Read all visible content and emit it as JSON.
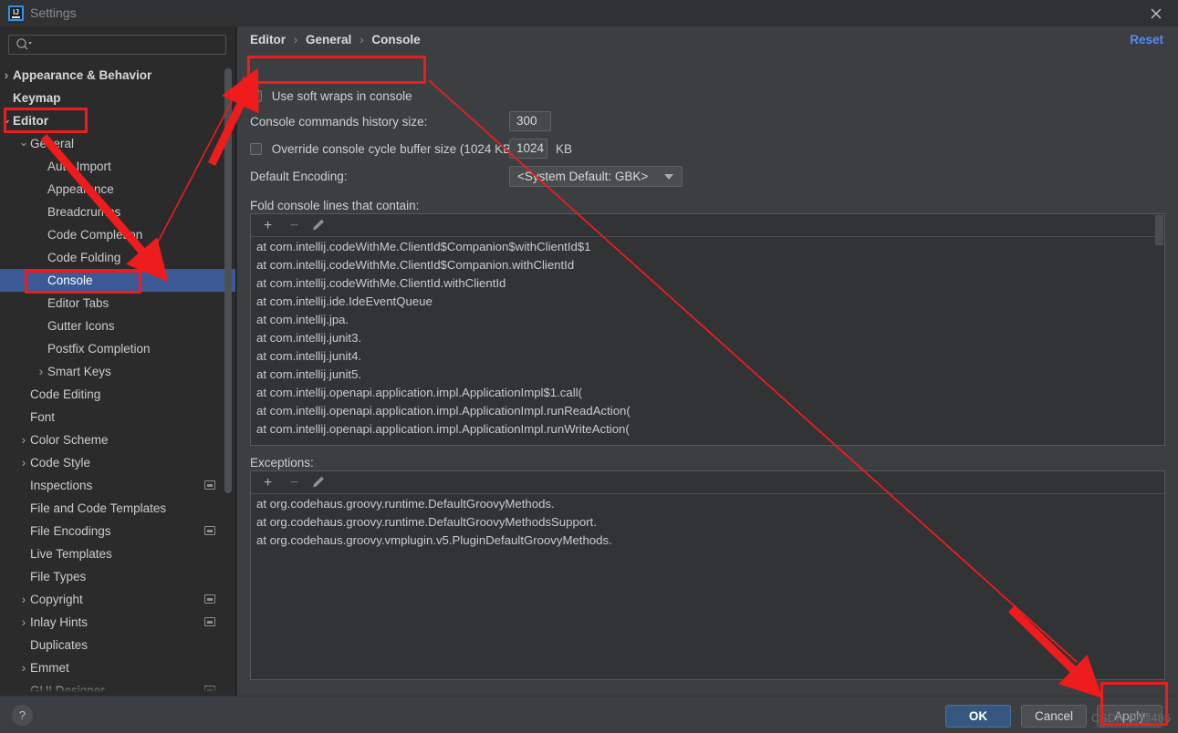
{
  "window": {
    "title": "Settings",
    "app_icon": "intellij-idea-icon",
    "close_icon": "close-icon"
  },
  "sidebar": {
    "search": {
      "placeholder": "",
      "value": "",
      "icon": "search-icon"
    },
    "items": [
      {
        "label": "Appearance & Behavior",
        "indent": 0,
        "arrow": "collapsed",
        "bold": true,
        "selected": false,
        "badge": false
      },
      {
        "label": "Keymap",
        "indent": 0,
        "arrow": "none",
        "bold": true,
        "selected": false,
        "badge": false
      },
      {
        "label": "Editor",
        "indent": 0,
        "arrow": "expanded",
        "bold": true,
        "selected": false,
        "badge": false
      },
      {
        "label": "General",
        "indent": 1,
        "arrow": "expanded",
        "bold": false,
        "selected": false,
        "badge": false
      },
      {
        "label": "Auto Import",
        "indent": 2,
        "arrow": "none",
        "bold": false,
        "selected": false,
        "badge": false
      },
      {
        "label": "Appearance",
        "indent": 2,
        "arrow": "none",
        "bold": false,
        "selected": false,
        "badge": false
      },
      {
        "label": "Breadcrumbs",
        "indent": 2,
        "arrow": "none",
        "bold": false,
        "selected": false,
        "badge": false
      },
      {
        "label": "Code Completion",
        "indent": 2,
        "arrow": "none",
        "bold": false,
        "selected": false,
        "badge": false
      },
      {
        "label": "Code Folding",
        "indent": 2,
        "arrow": "none",
        "bold": false,
        "selected": false,
        "badge": false
      },
      {
        "label": "Console",
        "indent": 2,
        "arrow": "none",
        "bold": false,
        "selected": true,
        "badge": false
      },
      {
        "label": "Editor Tabs",
        "indent": 2,
        "arrow": "none",
        "bold": false,
        "selected": false,
        "badge": false
      },
      {
        "label": "Gutter Icons",
        "indent": 2,
        "arrow": "none",
        "bold": false,
        "selected": false,
        "badge": false
      },
      {
        "label": "Postfix Completion",
        "indent": 2,
        "arrow": "none",
        "bold": false,
        "selected": false,
        "badge": false
      },
      {
        "label": "Smart Keys",
        "indent": 2,
        "arrow": "collapsed",
        "bold": false,
        "selected": false,
        "badge": false
      },
      {
        "label": "Code Editing",
        "indent": 1,
        "arrow": "none",
        "bold": false,
        "selected": false,
        "badge": false
      },
      {
        "label": "Font",
        "indent": 1,
        "arrow": "none",
        "bold": false,
        "selected": false,
        "badge": false
      },
      {
        "label": "Color Scheme",
        "indent": 1,
        "arrow": "collapsed",
        "bold": false,
        "selected": false,
        "badge": false
      },
      {
        "label": "Code Style",
        "indent": 1,
        "arrow": "collapsed",
        "bold": false,
        "selected": false,
        "badge": false
      },
      {
        "label": "Inspections",
        "indent": 1,
        "arrow": "none",
        "bold": false,
        "selected": false,
        "badge": true
      },
      {
        "label": "File and Code Templates",
        "indent": 1,
        "arrow": "none",
        "bold": false,
        "selected": false,
        "badge": false
      },
      {
        "label": "File Encodings",
        "indent": 1,
        "arrow": "none",
        "bold": false,
        "selected": false,
        "badge": true
      },
      {
        "label": "Live Templates",
        "indent": 1,
        "arrow": "none",
        "bold": false,
        "selected": false,
        "badge": false
      },
      {
        "label": "File Types",
        "indent": 1,
        "arrow": "none",
        "bold": false,
        "selected": false,
        "badge": false
      },
      {
        "label": "Copyright",
        "indent": 1,
        "arrow": "collapsed",
        "bold": false,
        "selected": false,
        "badge": true
      },
      {
        "label": "Inlay Hints",
        "indent": 1,
        "arrow": "collapsed",
        "bold": false,
        "selected": false,
        "badge": true
      },
      {
        "label": "Duplicates",
        "indent": 1,
        "arrow": "none",
        "bold": false,
        "selected": false,
        "badge": false
      },
      {
        "label": "Emmet",
        "indent": 1,
        "arrow": "collapsed",
        "bold": false,
        "selected": false,
        "badge": false
      },
      {
        "label": "GUI Designer",
        "indent": 1,
        "arrow": "none",
        "bold": false,
        "selected": false,
        "badge": true
      }
    ]
  },
  "main": {
    "breadcrumb": {
      "part1": "Editor",
      "part2": "General",
      "part3": "Console",
      "separator": "›"
    },
    "reset_label": "Reset",
    "soft_wraps": {
      "label": "Use soft wraps in console",
      "checked": true
    },
    "history": {
      "label": "Console commands history size:",
      "value": "300"
    },
    "override_buffer": {
      "label": "Override console cycle buffer size (1024 KB)",
      "checked": false,
      "value": "1024",
      "unit": "KB"
    },
    "encoding": {
      "label": "Default Encoding:",
      "value": "<System Default: GBK>"
    },
    "fold_section": {
      "label": "Fold console lines that contain:",
      "toolbar": {
        "add": "+",
        "remove": "−",
        "edit": "pencil-icon"
      },
      "items": [
        "at com.intellij.codeWithMe.ClientId$Companion$withClientId$1",
        "at com.intellij.codeWithMe.ClientId$Companion.withClientId",
        "at com.intellij.codeWithMe.ClientId.withClientId",
        "at com.intellij.ide.IdeEventQueue",
        "at com.intellij.jpa.",
        "at com.intellij.junit3.",
        "at com.intellij.junit4.",
        "at com.intellij.junit5.",
        "at com.intellij.openapi.application.impl.ApplicationImpl$1.call(",
        "at com.intellij.openapi.application.impl.ApplicationImpl.runReadAction(",
        "at com.intellij.openapi.application.impl.ApplicationImpl.runWriteAction("
      ]
    },
    "exceptions_section": {
      "label": "Exceptions:",
      "toolbar": {
        "add": "+",
        "remove": "−",
        "edit": "pencil-icon"
      },
      "items": [
        "at org.codehaus.groovy.runtime.DefaultGroovyMethods.",
        "at org.codehaus.groovy.runtime.DefaultGroovyMethodsSupport.",
        "at org.codehaus.groovy.vmplugin.v5.PluginDefaultGroovyMethods."
      ]
    }
  },
  "footer": {
    "help_label": "?",
    "ok_label": "OK",
    "cancel_label": "Cancel",
    "apply_label": "Apply",
    "watermark": "CSDN @师486"
  },
  "colors": {
    "accent_blue": "#3c5a96",
    "link_blue": "#548af7",
    "ok_button": "#365880",
    "annotation_red": "#ee1c1c",
    "panel_bg": "#3c3f41",
    "sidebar_bg": "#2b2b2b"
  }
}
